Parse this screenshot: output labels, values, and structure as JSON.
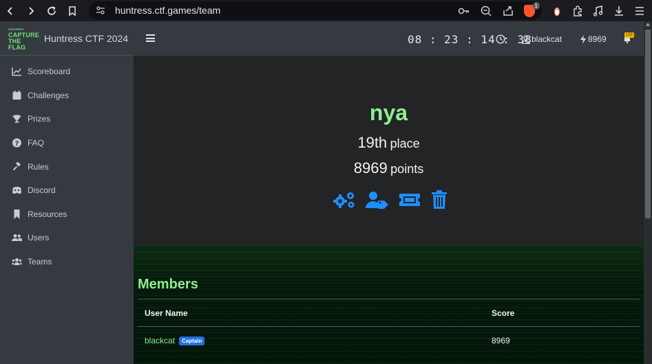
{
  "browser": {
    "url": "huntress.ctf.games/team",
    "shield_count": "1"
  },
  "brand": {
    "logo_line1": "HUNTRESS",
    "logo_line2": "CAPTURE",
    "logo_line3": "THE FLAG",
    "name": "Huntress CTF 2024"
  },
  "sidebar": {
    "items": [
      {
        "label": "Scoreboard",
        "icon": "chart-line-icon"
      },
      {
        "label": "Challenges",
        "icon": "calendar-icon"
      },
      {
        "label": "Prizes",
        "icon": "trophy-icon"
      },
      {
        "label": "FAQ",
        "icon": "question-circle-icon"
      },
      {
        "label": "Rules",
        "icon": "gavel-icon"
      },
      {
        "label": "Discord",
        "icon": "discord-icon"
      },
      {
        "label": "Resources",
        "icon": "bookmark-icon"
      },
      {
        "label": "Users",
        "icon": "users-icon"
      },
      {
        "label": "Teams",
        "icon": "teams-icon"
      }
    ]
  },
  "topbar": {
    "timer": "08:23:14:38",
    "username": "blackcat",
    "points": "8969",
    "notif_badge": "158"
  },
  "team": {
    "name": "nya",
    "place_num": "19th",
    "place_label": "place",
    "points_num": "8969",
    "points_label": "points"
  },
  "members": {
    "title": "Members",
    "headers": [
      "User Name",
      "Score"
    ],
    "rows": [
      {
        "name": "blackcat",
        "badge": "Captain",
        "score": "8969"
      }
    ]
  },
  "colors": {
    "accent_green": "#8ef08e",
    "action_blue": "#1f8fff",
    "sidebar_bg": "#343a40"
  }
}
